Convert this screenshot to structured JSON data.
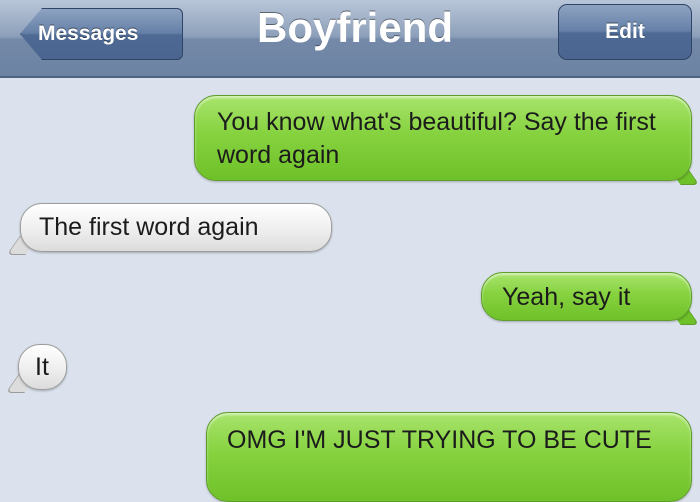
{
  "navbar": {
    "back_label": "Messages",
    "title": "Boyfriend",
    "edit_label": "Edit"
  },
  "messages": [
    {
      "direction": "sent",
      "text": "You know what's beautiful? Say the first word again"
    },
    {
      "direction": "received",
      "text": "The first word again"
    },
    {
      "direction": "sent",
      "text": "Yeah, say it"
    },
    {
      "direction": "received",
      "text": "It"
    },
    {
      "direction": "sent",
      "text": "OMG I'M JUST TRYING TO BE CUTE"
    }
  ],
  "colors": {
    "sent_bubble": "#86d23f",
    "received_bubble": "#eeeeee",
    "background": "#dbe2ed",
    "navbar": "#7489a8"
  }
}
